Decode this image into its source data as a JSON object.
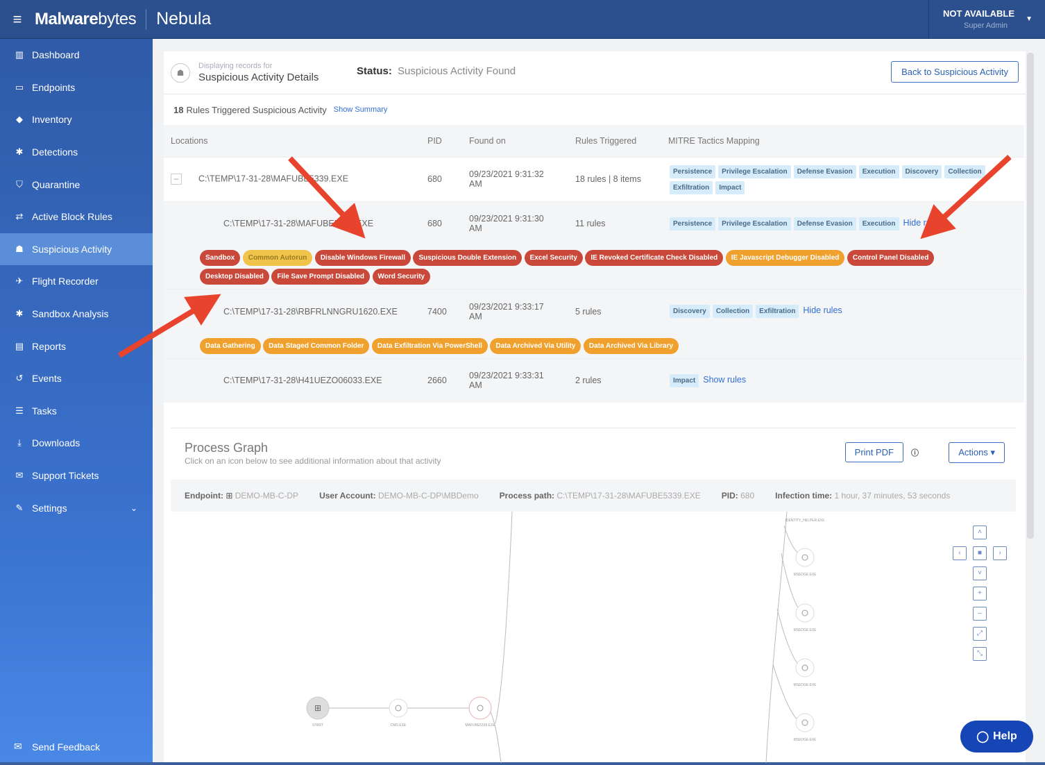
{
  "topbar": {
    "brand_bold": "Malware",
    "brand_lite": "bytes",
    "product": "Nebula",
    "user_name": "NOT AVAILABLE",
    "user_role": "Super Admin"
  },
  "sidebar": {
    "items": [
      {
        "label": "Dashboard",
        "icon": "bar-chart-icon"
      },
      {
        "label": "Endpoints",
        "icon": "monitor-icon"
      },
      {
        "label": "Inventory",
        "icon": "tag-icon"
      },
      {
        "label": "Detections",
        "icon": "bug-icon"
      },
      {
        "label": "Quarantine",
        "icon": "shield-icon"
      },
      {
        "label": "Active Block Rules",
        "icon": "arrows-icon"
      },
      {
        "label": "Suspicious Activity",
        "icon": "user-secret-icon"
      },
      {
        "label": "Flight Recorder",
        "icon": "plane-icon"
      },
      {
        "label": "Sandbox Analysis",
        "icon": "bug-icon"
      },
      {
        "label": "Reports",
        "icon": "document-icon"
      },
      {
        "label": "Events",
        "icon": "history-icon"
      },
      {
        "label": "Tasks",
        "icon": "list-icon"
      },
      {
        "label": "Downloads",
        "icon": "download-icon"
      },
      {
        "label": "Support Tickets",
        "icon": "chat-icon"
      },
      {
        "label": "Settings",
        "icon": "wrench-icon"
      }
    ],
    "feedback": "Send Feedback"
  },
  "header": {
    "displaying": "Displaying records for",
    "title": "Suspicious Activity Details",
    "status_label": "Status:",
    "status_value": "Suspicious Activity Found",
    "back_button": "Back to Suspicious Activity"
  },
  "summary": {
    "count": "18",
    "text": "Rules Triggered Suspicious Activity",
    "link": "Show Summary"
  },
  "table": {
    "headers": [
      "Locations",
      "PID",
      "Found on",
      "Rules Triggered",
      "MITRE Tactics Mapping"
    ],
    "rows": [
      {
        "location": "C:\\TEMP\\17-31-28\\MAFUBE5339.EXE",
        "pid": "680",
        "found_line1": "09/23/2021 9:31:32",
        "found_line2": "AM",
        "rules": "18 rules | 8 items",
        "tactics": [
          "Persistence",
          "Privilege Escalation",
          "Defense Evasion",
          "Execution",
          "Discovery",
          "Collection",
          "Exfiltration",
          "Impact"
        ],
        "link": ""
      },
      {
        "location": "C:\\TEMP\\17-31-28\\MAFUBE5339.EXE",
        "pid": "680",
        "found_line1": "09/23/2021 9:31:30",
        "found_line2": "AM",
        "rules": "11 rules",
        "tactics": [
          "Persistence",
          "Privilege Escalation",
          "Defense Evasion",
          "Execution"
        ],
        "link": "Hide rules"
      },
      {
        "location": "C:\\TEMP\\17-31-28\\RBFRLNNGRU1620.EXE",
        "pid": "7400",
        "found_line1": "09/23/2021 9:33:17",
        "found_line2": "AM",
        "rules": "5 rules",
        "tactics": [
          "Discovery",
          "Collection",
          "Exfiltration"
        ],
        "link": "Hide rules"
      },
      {
        "location": "C:\\TEMP\\17-31-28\\H41UEZO06033.EXE",
        "pid": "2660",
        "found_line1": "09/23/2021 9:33:31",
        "found_line2": "AM",
        "rules": "2 rules",
        "tactics": [
          "Impact"
        ],
        "link": "Show rules"
      }
    ],
    "chips_a": [
      {
        "label": "Sandbox",
        "color": "red"
      },
      {
        "label": "Common Autorun",
        "color": "yellow"
      },
      {
        "label": "Disable Windows Firewall",
        "color": "red"
      },
      {
        "label": "Suspicious Double Extension",
        "color": "red"
      },
      {
        "label": "Excel Security",
        "color": "red"
      },
      {
        "label": "IE Revoked Certificate Check Disabled",
        "color": "red"
      },
      {
        "label": "IE Javascript Debugger Disabled",
        "color": "orange"
      },
      {
        "label": "Control Panel Disabled",
        "color": "red"
      },
      {
        "label": "Desktop Disabled",
        "color": "red"
      },
      {
        "label": "File Save Prompt Disabled",
        "color": "red"
      },
      {
        "label": "Word Security",
        "color": "red"
      }
    ],
    "chips_b": [
      {
        "label": "Data Gathering",
        "color": "orange"
      },
      {
        "label": "Data Staged Common Folder",
        "color": "orange"
      },
      {
        "label": "Data Exfiltration Via PowerShell",
        "color": "orange"
      },
      {
        "label": "Data Archived Via Utility",
        "color": "orange"
      },
      {
        "label": "Data Archived Via Library",
        "color": "orange"
      }
    ]
  },
  "graph": {
    "title": "Process Graph",
    "subtitle": "Click on an icon below to see additional information about that activity",
    "print_button": "Print PDF",
    "actions_button": "Actions",
    "meta": {
      "endpoint_label": "Endpoint:",
      "endpoint_value": "DEMO-MB-C-DP",
      "user_label": "User Account:",
      "user_value": "DEMO-MB-C-DP\\MBDemo",
      "path_label": "Process path:",
      "path_value": "C:\\TEMP\\17-31-28\\MAFUBE5339.EXE",
      "pid_label": "PID:",
      "pid_value": "680",
      "infection_label": "Infection time:",
      "infection_value": "1 hour, 37 minutes, 53 seconds"
    },
    "nodes": [
      "START",
      "CMD.EXE",
      "MAFUBE5339.EXE",
      "IDENTITY_HELPER.EXE",
      "MSEDGE.EXE",
      "MSEDGE.EXE",
      "MSEDGE.EXE",
      "MSEDGE.EXE"
    ]
  },
  "help": {
    "label": "Help"
  },
  "colors": {
    "accent": "#2c4f8e",
    "alert_red": "#c9483a",
    "alert_orange": "#f0a02d",
    "arrow": "#e8432d"
  }
}
